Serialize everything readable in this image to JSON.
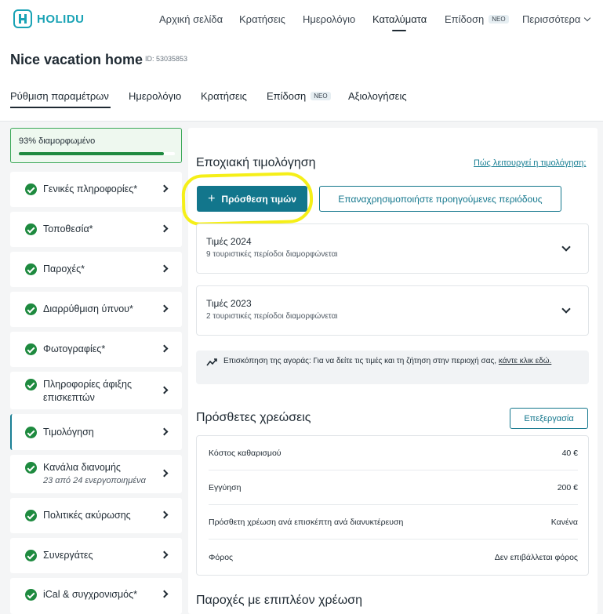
{
  "brand": {
    "name": "HOLIDU",
    "color": "#1aa3b5"
  },
  "topnav": {
    "items": [
      {
        "label": "Αρχική σελίδα"
      },
      {
        "label": "Κρατήσεις"
      },
      {
        "label": "Ημερολόγιο"
      },
      {
        "label": "Καταλύματα",
        "active": true
      },
      {
        "label": "Επίδοση",
        "badge": "ΝΕΟ"
      },
      {
        "label": "Περισσότερα"
      }
    ]
  },
  "property": {
    "name": "Nice vacation home",
    "id_label": "ID: 53035853"
  },
  "tabs": [
    {
      "label": "Ρύθμιση παραμέτρων",
      "active": true
    },
    {
      "label": "Ημερολόγιο"
    },
    {
      "label": "Κρατήσεις"
    },
    {
      "label": "Επίδοση",
      "badge": "ΝΕΟ"
    },
    {
      "label": "Αξιολογήσεις"
    }
  ],
  "progress": {
    "label": "93% διαμορφωμένο",
    "value": 0.93
  },
  "sidebar": {
    "items": [
      {
        "label": "Γενικές πληροφορίες*"
      },
      {
        "label": "Τοποθεσία*"
      },
      {
        "label": "Παροχές*"
      },
      {
        "label": "Διαρρύθμιση ύπνου*"
      },
      {
        "label": "Φωτογραφίες*"
      },
      {
        "label": "Πληροφορίες άφιξης",
        "label2": "επισκεπτών"
      },
      {
        "label": "Τιμολόγηση",
        "active": true
      },
      {
        "label": "Κανάλια διανομής",
        "sub": "23 από 24 ενεργοποιημένα"
      },
      {
        "label": "Πολιτικές ακύρωσης"
      },
      {
        "label": "Συνεργάτες"
      },
      {
        "label": "iCal & συγχρονισμός*"
      }
    ]
  },
  "pricing": {
    "title": "Εποχιακή τιμολόγηση",
    "help_link": "Πώς λειτουργεί η τιμολόγηση;",
    "add_button": "Πρόσθεση τιμών",
    "reuse_button": "Επαναχρησιμοποιήστε προηγούμενες περιόδους",
    "seasons": [
      {
        "title": "Τιμές 2024",
        "sub": "9 τουριστικές περίοδοι διαμορφώνεται"
      },
      {
        "title": "Τιμές 2023",
        "sub": "2 τουριστικές περίοδοι διαμορφώνεται"
      }
    ],
    "market_text": "Επισκόπηση της αγοράς: Για να δείτε τις τιμές και τη ζήτηση στην περιοχή σας,",
    "market_link": "κάντε κλικ εδώ."
  },
  "fees": {
    "title": "Πρόσθετες χρεώσεις",
    "edit_button": "Επεξεργασία",
    "rows": [
      {
        "label": "Κόστος καθαρισμού",
        "value": "40 €"
      },
      {
        "label": "Εγγύηση",
        "value": "200 €"
      },
      {
        "label": "Πρόσθετη χρέωση ανά επισκέπτη ανά διανυκτέρευση",
        "value": "Κανένα"
      },
      {
        "label": "Φόρος",
        "value": "Δεν επιβάλλεται φόρος"
      }
    ]
  },
  "extras": {
    "title": "Παροχές με επιπλέον χρέωση"
  }
}
